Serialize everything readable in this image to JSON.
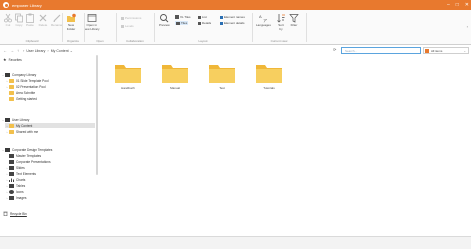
{
  "colors": {
    "titlebar": "#e8792e",
    "accent": "#e8792e",
    "folder": "#f2c04c",
    "selection": "#e2e2e2",
    "search_border": "#5ba4de"
  },
  "window": {
    "title": "empower Library",
    "minimize": "–",
    "maximize": "□",
    "close": "✕"
  },
  "ribbon": {
    "buttons": {
      "cut": "Cut",
      "copy": "Copy",
      "paste": "Paste",
      "delete": "Delete",
      "rename": "Rename",
      "new_folder": "New\nFolder",
      "open_new_library": "Open in\nnew Library",
      "permissions": "Permissions",
      "levels": "Levels",
      "preview": "Preview",
      "xl_tiles": "XL Tiles",
      "tiles": "Tiles",
      "list": "List",
      "details": "Details",
      "element_names": "Element names",
      "element_details": "Element details",
      "languages": "Languages",
      "sort_by": "Sort\nby",
      "filter": "Filter"
    },
    "groups": {
      "clipboard": "Clipboard",
      "organize": "Organize",
      "open": "Open",
      "collaboration": "Collaboration",
      "layout": "Layout",
      "current_view": "Current view"
    }
  },
  "navbar": {
    "back": "←",
    "forward": "→",
    "up": "↑",
    "breadcrumb": [
      "User Library",
      "My Content"
    ],
    "search_placeholder": "Search...",
    "scope_label": "All items"
  },
  "sidebar": {
    "favorites": "Favorites",
    "company_library": "Company Library",
    "company_items": [
      "01 Slide Template Pool",
      "02 Presentation Pool",
      "Area Schnitte",
      "Getting started"
    ],
    "user_library": "User Library",
    "user_items": [
      "My Content",
      "Shared with me"
    ],
    "corporate_templates": "Corporate Design Templates",
    "corporate_items": [
      "Master Templates",
      "Corporate Presentations",
      "Slides",
      "Text Elements",
      "Charts",
      "Tables",
      "Icons",
      "Images"
    ],
    "recycle_bin": "Recycle Bin"
  },
  "main": {
    "folders": [
      "Handbuch",
      "Manual",
      "Test",
      "Tutorials"
    ]
  }
}
